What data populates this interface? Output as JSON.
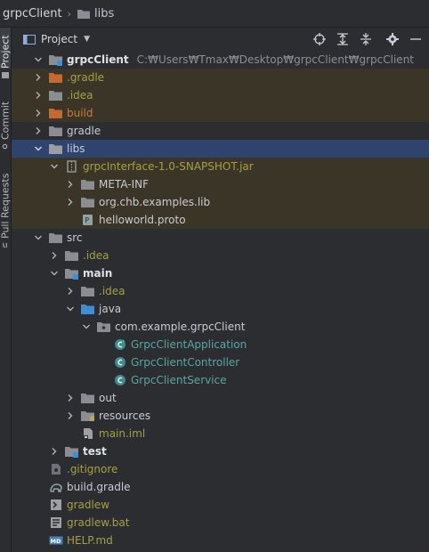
{
  "breadcrumb": {
    "root": "grpcClient",
    "folder": "libs"
  },
  "side_tabs": {
    "project": "Project",
    "commit": "Commit",
    "pull_requests": "Pull Requests"
  },
  "panel": {
    "title": "Project"
  },
  "tree": {
    "root": "grpcClient",
    "root_path": "C:₩Users₩Tmax₩Desktop₩grpcClient₩grpcClient",
    "gradle_dot": ".gradle",
    "idea_dot": ".idea",
    "build": "build",
    "gradle": "gradle",
    "libs": "libs",
    "jar": "grpcInterface-1.0-SNAPSHOT.jar",
    "meta_inf": "META-INF",
    "org_pkg": "org.chb.examples.lib",
    "proto": "helloworld.proto",
    "src": "src",
    "src_idea": ".idea",
    "main": "main",
    "main_idea": ".idea",
    "java": "java",
    "pkg": "com.example.grpcClient",
    "cls_app": "GrpcClientApplication",
    "cls_ctrl": "GrpcClientController",
    "cls_svc": "GrpcClientService",
    "out": "out",
    "resources": "resources",
    "main_iml": "main.iml",
    "test": "test",
    "gitignore": ".gitignore",
    "build_gradle": "build.gradle",
    "gradlew": "gradlew",
    "gradlew_bat": "gradlew.bat",
    "help": "HELP.md"
  },
  "colors": {
    "selection": "#2e436e",
    "excluded": "#3a3526",
    "folder": "#8a8d92",
    "java_class": "#5ba6a3",
    "module_mark": "#3d8fd6"
  }
}
